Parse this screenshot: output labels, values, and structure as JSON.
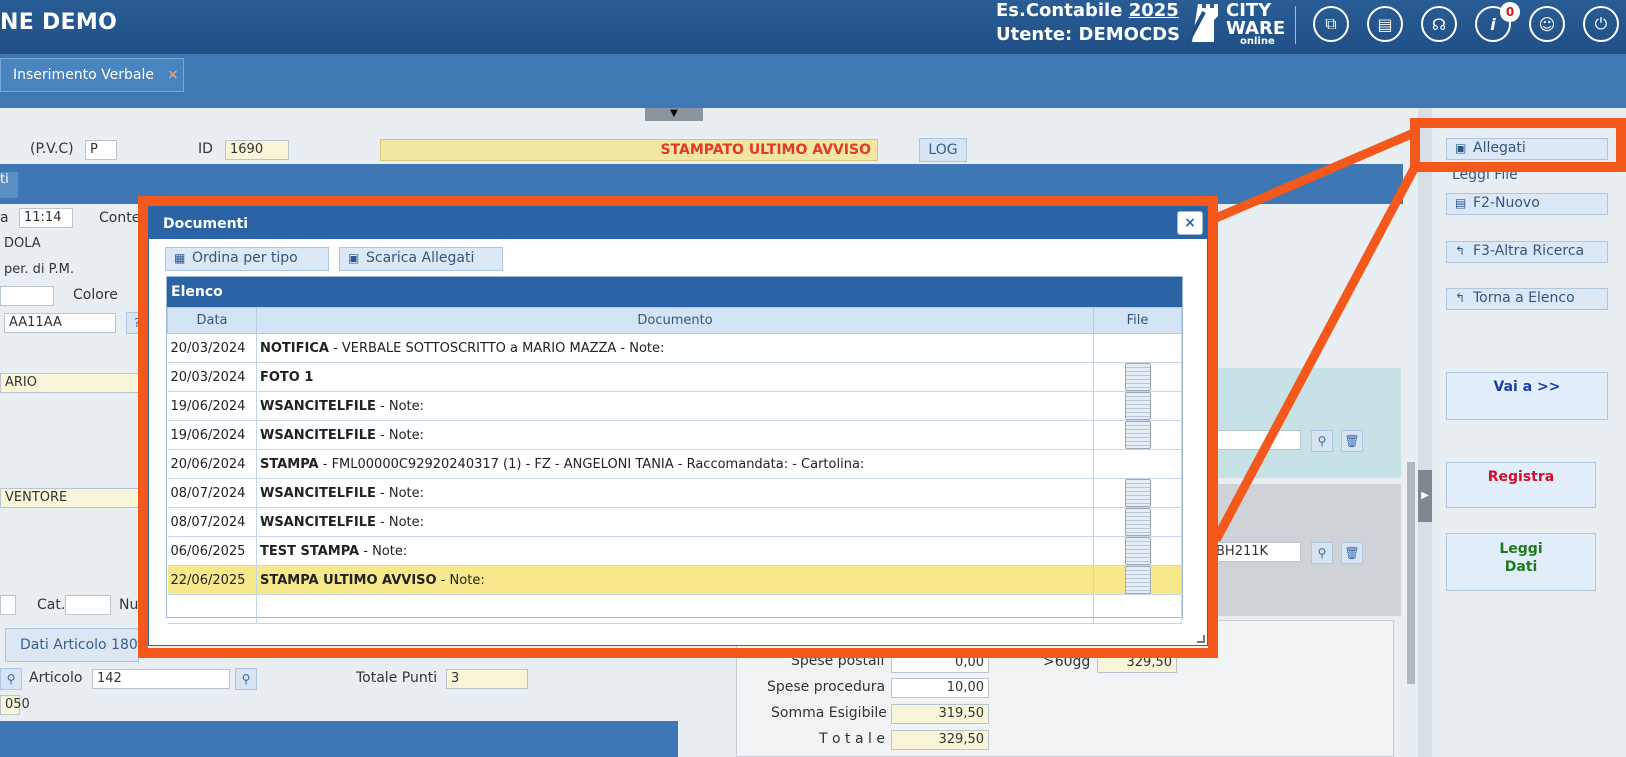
{
  "header": {
    "app_title": "NE DEMO",
    "es_label": "Es.Contabile",
    "es_year": "2025",
    "utente": "Utente: DEMOCDS",
    "logo_line1": "CITY",
    "logo_line2": "WARE",
    "logo_line3": "online",
    "notification_count": "0",
    "icons": [
      "windows-icon",
      "book-icon",
      "headset-icon",
      "info-icon",
      "user-icon",
      "power-icon"
    ]
  },
  "tabs": [
    {
      "label": "Inserimento Verbale",
      "close": "×"
    }
  ],
  "splitter_arrow": "▼",
  "form": {
    "pvc_label": "(P.V.C)",
    "pvc_value": "P",
    "id_label": "ID",
    "id_value": "1690",
    "status": "STAMPATO ULTIMO AVVISO",
    "log_label": "LOG",
    "band_stub": "ti",
    "time_prefix": "a",
    "time_value": "11:14",
    "cont_label": "Conte",
    "f_dola": "DOLA",
    "f_pm": "per. di P.M.",
    "colore_label": "Colore",
    "targa": "AA11AA",
    "q_btn": "?",
    "f_ario": "ARIO",
    "f_ventore": "VENTORE",
    "cat_label": "Cat.",
    "nu_label": "Nu",
    "art_tab": "Dati Articolo 180",
    "articolo_label": "Articolo",
    "articolo_value": "142",
    "totale_punti_label": "Totale Punti",
    "totale_punti_value": "3",
    "f_050": "050",
    "right_field": "BH211K"
  },
  "totals": {
    "spese_postali_label": "Spese postali",
    "spese_postali": "0,00",
    "gt60_label": ">60gg",
    "gt60": "329,50",
    "spese_procedura_label": "Spese procedura",
    "spese_procedura": "10,00",
    "somma_label": "Somma Esigibile",
    "somma": "319,50",
    "totale_label": "T o t a l e",
    "totale": "329,50"
  },
  "sidebar": {
    "allegati": "Allegati",
    "leggi_file": "Leggi File",
    "nuovo": "F2-Nuovo",
    "altra_ricerca": "F3-Altra Ricerca",
    "torna": "Torna a Elenco",
    "vai": "Vai a >>",
    "registra": "Registra",
    "leggi_dati_1": "Leggi",
    "leggi_dati_2": "Dati"
  },
  "modal": {
    "title": "Documenti",
    "close": "×",
    "ordina": "Ordina per tipo",
    "scarica": "Scarica Allegati",
    "caption": "Elenco",
    "columns": [
      "Data",
      "Documento",
      "File"
    ],
    "rows": [
      {
        "data": "20/03/2024",
        "tipo": "NOTIFICA",
        "desc": " - VERBALE SOTTOSCRITTO a MARIO MAZZA - Note:",
        "file": false
      },
      {
        "data": "20/03/2024",
        "tipo": "FOTO 1",
        "desc": "",
        "file": true
      },
      {
        "data": "19/06/2024",
        "tipo": "WSANCITELFILE",
        "desc": " - Note:",
        "file": true
      },
      {
        "data": "19/06/2024",
        "tipo": "WSANCITELFILE",
        "desc": " - Note:",
        "file": true
      },
      {
        "data": "20/06/2024",
        "tipo": "STAMPA",
        "desc": " - FML00000C92920240317 (1) - FZ - ANGELONI TANIA - Raccomandata:  - Cartolina:",
        "file": false
      },
      {
        "data": "08/07/2024",
        "tipo": "WSANCITELFILE",
        "desc": " - Note:",
        "file": true
      },
      {
        "data": "08/07/2024",
        "tipo": "WSANCITELFILE",
        "desc": " - Note:",
        "file": true
      },
      {
        "data": "06/06/2025",
        "tipo": "TEST STAMPA",
        "desc": " - Note:",
        "file": true
      },
      {
        "data": "22/06/2025",
        "tipo": "STAMPA ULTIMO AVVISO",
        "desc": " - Note:",
        "file": true,
        "selected": true
      }
    ]
  },
  "colors": {
    "accent": "#2a64a5",
    "highlight": "#f4581a",
    "status": "#e03a2a",
    "registra": "#d0102e",
    "leggi": "#1f7a1f"
  }
}
